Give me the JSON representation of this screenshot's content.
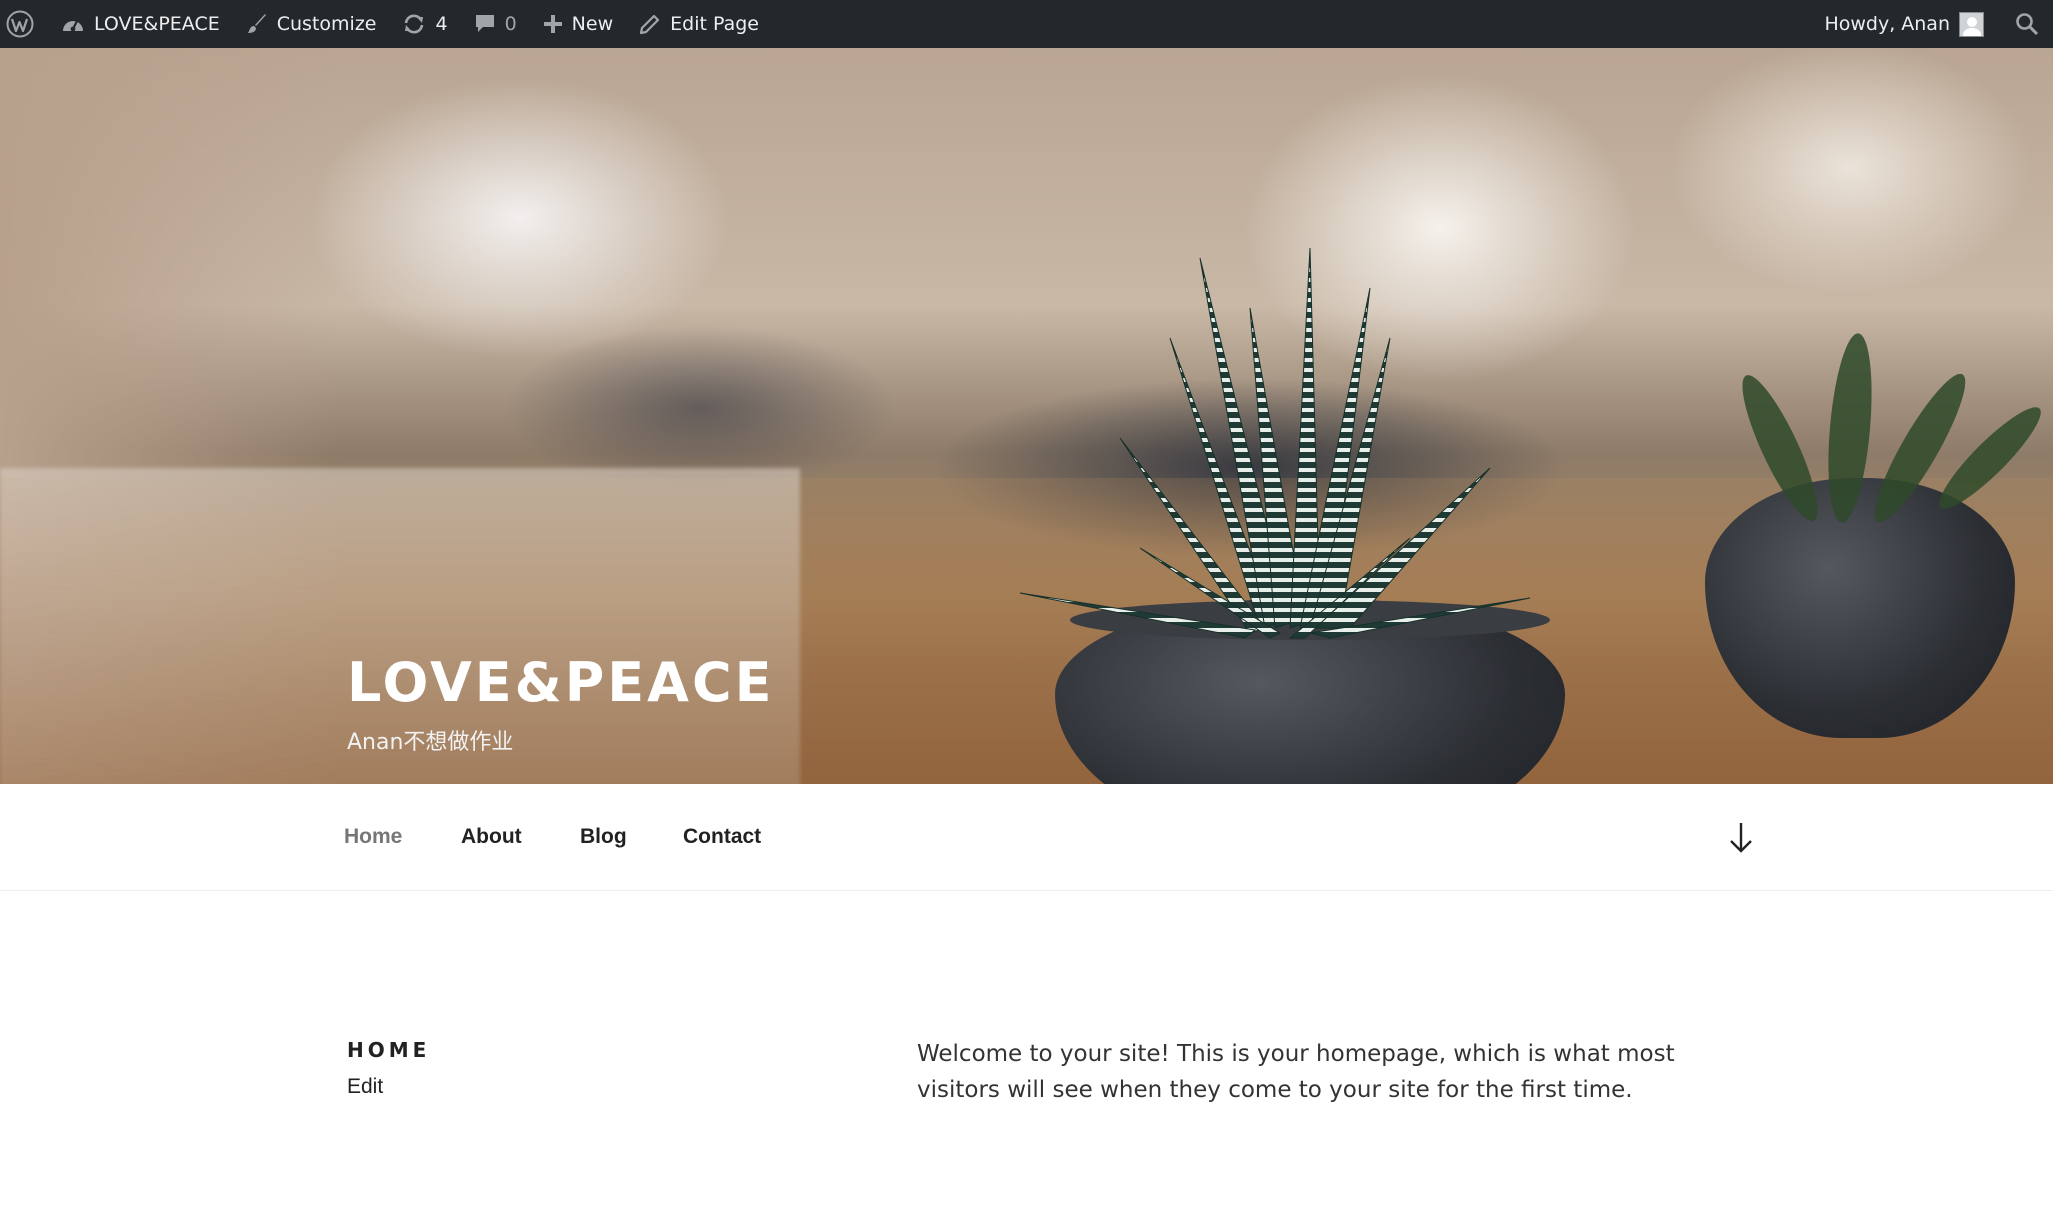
{
  "adminbar": {
    "wp_logo_icon": "wordpress-logo-icon",
    "site_name": "LOVE&PEACE",
    "customize_label": "Customize",
    "updates_count": "4",
    "comments_count": "0",
    "new_label": "New",
    "edit_page_label": "Edit Page",
    "howdy_label": "Howdy, Anan",
    "colors": {
      "background": "#23282d",
      "text": "#eeeeee",
      "icon": "#a0a5aa"
    }
  },
  "header": {
    "site_title": "LOVE&PEACE",
    "site_description": "Anan不想做作业"
  },
  "nav": {
    "items": [
      {
        "label": "Home",
        "current": true
      },
      {
        "label": "About",
        "current": false
      },
      {
        "label": "Blog",
        "current": false
      },
      {
        "label": "Contact",
        "current": false
      }
    ],
    "scroll_icon": "arrow-down-icon"
  },
  "content": {
    "page_title": "HOME",
    "edit_label": "Edit",
    "body_text": "Welcome to your site! This is your homepage, which is what most visitors will see when they come to your site for the first time."
  }
}
